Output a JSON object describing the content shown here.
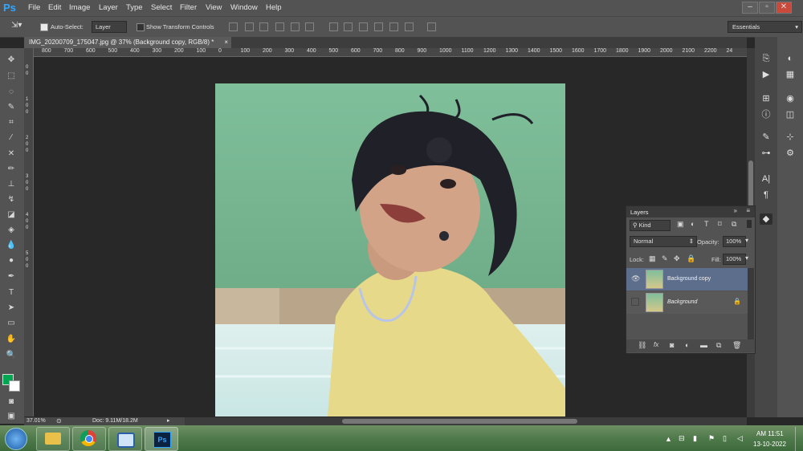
{
  "app": {
    "logo": "Ps"
  },
  "menu": [
    "File",
    "Edit",
    "Image",
    "Layer",
    "Type",
    "Select",
    "Filter",
    "View",
    "Window",
    "Help"
  ],
  "window_controls": [
    "–",
    "▫",
    "✕"
  ],
  "options": {
    "auto_select_label": "Auto-Select:",
    "auto_select_target": "Layer",
    "show_transform_label": "Show Transform Controls",
    "workspace": "Essentials"
  },
  "document": {
    "tab_title": "IMG_20200709_175047.jpg @ 37% (Background copy, RGB/8) *",
    "tab_close": "×"
  },
  "ruler": {
    "h_ticks": [
      "800",
      "700",
      "600",
      "500",
      "400",
      "300",
      "200",
      "100",
      "0",
      "100",
      "200",
      "300",
      "400",
      "500",
      "600",
      "700",
      "800",
      "900",
      "1000",
      "1100",
      "1200",
      "1300",
      "1400",
      "1500",
      "1600",
      "1700",
      "1800",
      "1900",
      "2000",
      "2100",
      "2200",
      "24"
    ]
  },
  "status": {
    "zoom": "37.01%",
    "doc_size": "Doc: 9.11M/18.2M"
  },
  "layers_panel": {
    "title": "Layers",
    "filter_kind": "Kind",
    "blend_mode": "Normal",
    "opacity_label": "Opacity:",
    "opacity_value": "100%",
    "lock_label": "Lock:",
    "fill_label": "Fill:",
    "fill_value": "100%",
    "layers": [
      {
        "name": "Background copy",
        "visible": true,
        "selected": true
      },
      {
        "name": "Background",
        "visible": false,
        "selected": false,
        "locked": true
      }
    ]
  },
  "taskbar": {
    "time": "AM 11:51",
    "date": "13-10-2022",
    "apps": [
      "start-orb",
      "file-explorer",
      "chrome",
      "snipping-tool",
      "photoshop"
    ]
  },
  "colors": {
    "foreground": "#00a651",
    "background": "#ffffff",
    "accent": "#31a8ff"
  }
}
